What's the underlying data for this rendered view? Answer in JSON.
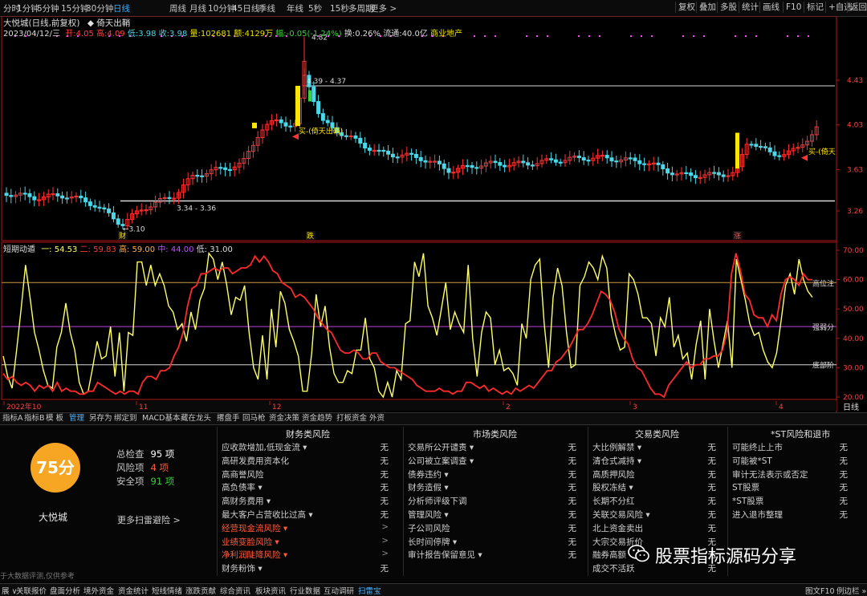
{
  "toolbar": {
    "periods": [
      "分时",
      "1分钟",
      "5分钟",
      "15分钟",
      "30分钟",
      "日线",
      "周线",
      "月线",
      "10分钟",
      "45日线",
      "季线",
      "年线",
      "5秒",
      "15秒",
      "多周期",
      "更多 >"
    ],
    "active_period": "日线",
    "right_buttons": [
      "复权",
      "叠加",
      "多股",
      "统计",
      "画线",
      "F10",
      "标记",
      "+自选",
      "返回"
    ]
  },
  "quote": {
    "title": "大悦城(日线,前复权)",
    "indicator_name": "◆ 倚天出鞘",
    "date": "2023/04/12/三",
    "open": "开:4.05",
    "high": "高:4.09",
    "low": "低:3.98",
    "close": "收:3.98",
    "volume": "量:102681",
    "amount": "额:4129万",
    "change": "幅:-0.05(-1.24%)",
    "turnover": "换:0.26%",
    "float_cap": "流通:40.0亿",
    "industry": "商业地产"
  },
  "main_chart": {
    "y_ticks": [
      "4.43",
      "4.03",
      "3.63",
      "3.26"
    ],
    "annotations": {
      "high_label": "4.82",
      "range_label_top": "4.39 - 4.37",
      "range_label_bottom": "3.34 - 3.36",
      "low_label": "3.10",
      "buy_label_1": "买-(倚天出鞘)",
      "buy_label_2": "买-(倚天"
    },
    "event_markers": [
      "财",
      "跌",
      "涨"
    ]
  },
  "oscillator": {
    "name": "短期动遁",
    "line1": "一: 54.53",
    "line2": "二: 59.83",
    "high": "高: 59.00",
    "mid": "中: 44.00",
    "low": "低: 31.00",
    "y_ticks": [
      "70.00",
      "60.00",
      "50.00",
      "40.00",
      "30.00",
      "20.00"
    ],
    "level_labels": [
      "高位注",
      "强弱分",
      "底部阶"
    ],
    "x_labels": [
      "2022年10",
      "11",
      "12",
      "2",
      "3",
      "4"
    ],
    "scale_button": "日线"
  },
  "chart_data": [
    {
      "type": "candlestick",
      "title": "大悦城(日线,前复权)",
      "y_ticks": [
        4.43,
        4.03,
        3.63,
        3.26
      ],
      "reference_lines": [
        4.38,
        3.35
      ],
      "annotations": {
        "high": 4.82,
        "low": 3.1
      }
    },
    {
      "type": "line",
      "title": "短期动遁",
      "ylim": [
        20,
        70
      ],
      "reference_lines": [
        59,
        44,
        31
      ],
      "series": [
        {
          "name": "一",
          "color": "#ffff66",
          "last": 54.53,
          "values": [
            34,
            27,
            23,
            36,
            50,
            65,
            54,
            42,
            36,
            29,
            24,
            23,
            37,
            42,
            52,
            42,
            36,
            25,
            21,
            22,
            30,
            39,
            33,
            34,
            44,
            27,
            42,
            22,
            42,
            41,
            66,
            66,
            58,
            65,
            58,
            62,
            58,
            51,
            49,
            43,
            45,
            39,
            49,
            43,
            53,
            57,
            69,
            67,
            60,
            66,
            58,
            48,
            54,
            53,
            58,
            42,
            30,
            26,
            41,
            26,
            50,
            37,
            56,
            52,
            43,
            39,
            34,
            22,
            22,
            35,
            55,
            44,
            51,
            37,
            28,
            25,
            25,
            29,
            28,
            36,
            36,
            47,
            33,
            30,
            22,
            20,
            25,
            20,
            29,
            26,
            45,
            46,
            66,
            61,
            69,
            51,
            47,
            41,
            50,
            59,
            43,
            49,
            45,
            42,
            65,
            40,
            27,
            42,
            49,
            47,
            31,
            36,
            29,
            30,
            28,
            24,
            45,
            40,
            60,
            65,
            67,
            45,
            30,
            54,
            64,
            58,
            42,
            30,
            31,
            58,
            61,
            66,
            64,
            60,
            68,
            64,
            48,
            41,
            36,
            37,
            62,
            60,
            55,
            47,
            47,
            45,
            34,
            47,
            44,
            54,
            37,
            41,
            33,
            35,
            26,
            38,
            46,
            26,
            50,
            39,
            30,
            38,
            46,
            30,
            67,
            60,
            53,
            45,
            41,
            42,
            36,
            32,
            30,
            35,
            46,
            58,
            62,
            55,
            67,
            60,
            56,
            54
          ]
        },
        {
          "name": "二",
          "color": "#ff2a2a",
          "last": 59.83,
          "values": [
            28,
            26,
            27,
            25,
            24,
            25,
            24,
            22,
            24,
            23,
            24,
            22,
            25,
            22,
            23,
            22,
            22,
            21,
            21,
            22,
            22,
            25,
            24,
            23,
            22,
            21,
            22,
            21,
            22,
            22,
            21,
            25,
            27,
            27,
            26,
            29,
            29,
            30,
            34,
            37,
            42,
            51,
            57,
            58,
            62,
            62,
            63,
            64,
            63,
            64,
            64,
            62,
            63,
            64,
            64,
            65,
            68,
            66,
            68,
            66,
            63,
            62,
            59,
            58,
            57,
            54,
            55,
            54,
            52,
            50,
            47,
            45,
            43,
            42,
            39,
            36,
            35,
            35,
            36,
            35,
            33,
            33,
            35,
            35,
            32,
            31,
            30,
            30,
            29,
            28,
            27,
            26,
            24,
            23,
            22,
            22,
            22,
            23,
            22,
            22,
            21,
            22,
            22,
            25,
            25,
            24,
            23,
            24,
            22,
            23,
            22,
            21,
            22,
            21,
            23,
            22,
            23,
            24,
            23,
            25,
            27,
            29,
            29,
            32,
            33,
            35,
            37,
            40,
            43,
            43,
            45,
            48,
            52,
            56,
            55,
            53,
            49,
            43,
            40,
            38,
            33,
            30,
            29,
            26,
            23,
            21,
            21,
            20,
            24,
            26,
            28,
            30,
            32,
            30,
            31,
            31,
            33,
            33,
            34,
            34,
            36,
            42,
            62,
            69,
            63,
            55,
            53,
            48,
            47,
            47,
            44,
            48,
            46,
            55,
            60,
            61,
            60,
            58,
            62,
            60,
            60
          ]
        }
      ]
    }
  ],
  "tabs": {
    "items": [
      "指标A",
      "指标B",
      "模 板",
      "管理",
      "另存为",
      "绑定到",
      "MACD基本",
      "藏在龙头",
      "撂盘手",
      "回马枪",
      "资金决策",
      "资金趋势",
      "打板资金",
      "外资"
    ],
    "active": "管理"
  },
  "scan": {
    "score": "75分",
    "stock_name": "大悦城",
    "stats": [
      {
        "label": "总检查",
        "value": "95 项",
        "color": "#ffffff"
      },
      {
        "label": "风险项",
        "value": "4 项",
        "color": "#ff5a3c"
      },
      {
        "label": "安全项",
        "value": "91 项",
        "color": "#3ad13a"
      }
    ],
    "more_link": "更多扫雷避险 >",
    "disclaimer": "于大数据评测,仅供参考",
    "columns": [
      {
        "title": "财务类风险",
        "items": [
          {
            "label": "应收款增加,低现金流 ▾",
            "value": "无",
            "hot": false
          },
          {
            "label": "高研发费用资本化",
            "value": "无",
            "hot": false
          },
          {
            "label": "高商誉风险",
            "value": "无",
            "hot": false
          },
          {
            "label": "高负债率 ▾",
            "value": "无",
            "hot": false
          },
          {
            "label": "高财务费用 ▾",
            "value": "无",
            "hot": false
          },
          {
            "label": "最大客户占营收比过高 ▾",
            "value": "无",
            "hot": false
          },
          {
            "label": "经营现金流风险 ▾",
            "value": ">",
            "hot": true
          },
          {
            "label": "业绩变脸风险 ▾",
            "value": ">",
            "hot": true
          },
          {
            "label": "净利润陡降风险 ▾",
            "value": ">",
            "hot": true
          },
          {
            "label": "财务粉饰 ▾",
            "value": "无",
            "hot": false
          }
        ]
      },
      {
        "title": "市场类风险",
        "items": [
          {
            "label": "交易所公开谴责 ▾",
            "value": "无",
            "hot": false
          },
          {
            "label": "公司被立案调查 ▾",
            "value": "无",
            "hot": false
          },
          {
            "label": "债券违约 ▾",
            "value": "无",
            "hot": false
          },
          {
            "label": "财务造假 ▾",
            "value": "无",
            "hot": false
          },
          {
            "label": "分析师评级下调",
            "value": "无",
            "hot": false
          },
          {
            "label": "管理风险 ▾",
            "value": "无",
            "hot": false
          },
          {
            "label": "子公司风险",
            "value": "无",
            "hot": false
          },
          {
            "label": "长时间停牌 ▾",
            "value": "无",
            "hot": false
          },
          {
            "label": "审计报告保留意见 ▾",
            "value": "无",
            "hot": false
          }
        ]
      },
      {
        "title": "交易类风险",
        "items": [
          {
            "label": "大比例解禁 ▾",
            "value": "无",
            "hot": false
          },
          {
            "label": "清仓式减持 ▾",
            "value": "无",
            "hot": false
          },
          {
            "label": "高质押风险",
            "value": "无",
            "hot": false
          },
          {
            "label": "股权冻结 ▾",
            "value": "无",
            "hot": false
          },
          {
            "label": "长期不分红",
            "value": "无",
            "hot": false
          },
          {
            "label": "关联交易风险 ▾",
            "value": "无",
            "hot": false
          },
          {
            "label": "北上资金卖出",
            "value": "无",
            "hot": false
          },
          {
            "label": "大宗交易折价",
            "value": "无",
            "hot": false
          },
          {
            "label": "融券高额",
            "value": "无",
            "hot": false
          },
          {
            "label": "成交不活跃",
            "value": "无",
            "hot": false
          }
        ]
      },
      {
        "title": "*ST风险和退市",
        "items": [
          {
            "label": "可能终止上市",
            "value": "无",
            "hot": false
          },
          {
            "label": "可能被*ST",
            "value": "无",
            "hot": false
          },
          {
            "label": "审计无法表示或否定",
            "value": "无",
            "hot": false
          },
          {
            "label": "ST股票",
            "value": "无",
            "hot": false
          },
          {
            "label": "*ST股票",
            "value": "无",
            "hot": false
          },
          {
            "label": "进入退市整理",
            "value": "无",
            "hot": false
          }
        ]
      }
    ]
  },
  "bottombar": {
    "items": [
      "展 ∨",
      "关联报价",
      "盘面分析",
      "境外资金",
      "资金统计",
      "短线情绪",
      "涨跌贡献",
      "综合资讯",
      "板块资讯",
      "行业数据",
      "互动调研",
      "扫雷宝"
    ],
    "active": "扫雷宝",
    "right_items": [
      "图文F10",
      "例边栏 »"
    ]
  },
  "watermark": "股票指标源码分享",
  "colors": {
    "up": "#ff3333",
    "down": "#4bd8e8",
    "accent": "#3fb1ff",
    "score_bg": "#f6a623"
  }
}
